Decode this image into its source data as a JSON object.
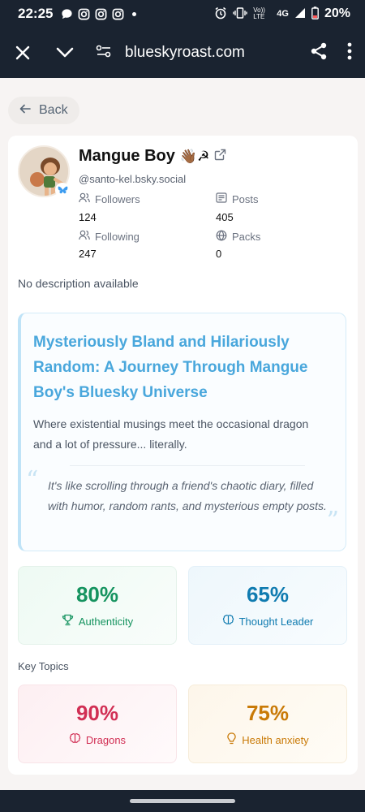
{
  "status_bar": {
    "time": "22:25",
    "network_label": "Vo)) LTE",
    "network_type": "4G",
    "battery": "20%"
  },
  "browser": {
    "url": "blueskyroast.com",
    "icons": [
      "close-icon",
      "chevron-down-icon",
      "site-settings-icon",
      "share-icon",
      "more-vert-icon"
    ]
  },
  "back_label": "Back",
  "profile": {
    "name": "Mangue Boy",
    "name_emoji": "👋🏾☭",
    "handle": "@santo-kel.bsky.social",
    "followers_label": "Followers",
    "followers": "124",
    "posts_label": "Posts",
    "posts": "405",
    "following_label": "Following",
    "following": "247",
    "packs_label": "Packs",
    "packs": "0",
    "description": "No description available"
  },
  "roast": {
    "title": "Mysteriously Bland and Hilariously Random: A Journey Through Mangue Boy's Bluesky Universe",
    "subtitle": "Where existential musings meet the occasional dragon and a lot of pressure... literally.",
    "quote": "It's like scrolling through a friend's chaotic diary, filled with humor, random rants, and mysterious empty posts."
  },
  "scores": {
    "authenticity_value": "80%",
    "authenticity_label": "Authenticity",
    "thought_leader_value": "65%",
    "thought_leader_label": "Thought Leader"
  },
  "key_topics_label": "Key Topics",
  "topics": {
    "dragons_value": "90%",
    "dragons_label": "Dragons",
    "health_value": "75%",
    "health_label": "Health anxiety"
  },
  "colors": {
    "accent_blue": "#49a7dc",
    "authenticity_green": "#15935f",
    "thought_leader_blue": "#0f7bb0",
    "dragons_red": "#d12f54",
    "health_amber": "#c97a07"
  }
}
